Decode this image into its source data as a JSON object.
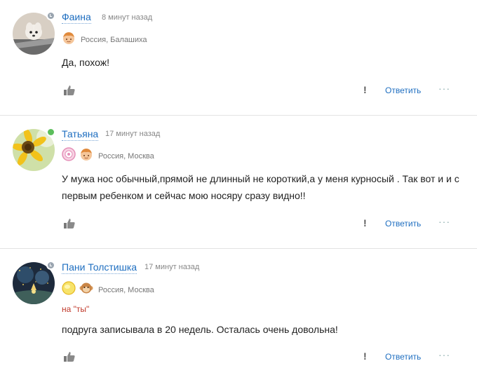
{
  "comments": [
    {
      "author": "Фаина",
      "time": "8 минут назад",
      "location": "Россия, Балашиха",
      "status": "away",
      "badges": [
        "boy-avatar-icon"
      ],
      "tag": "",
      "text": "Да, похож!",
      "actions": {
        "report": "!",
        "reply": "Ответить",
        "more": "···"
      }
    },
    {
      "author": "Татьяна",
      "time": "17 минут назад",
      "location": "Россия, Москва",
      "status": "online",
      "badges": [
        "pink-circle-badge-icon",
        "boy-avatar-icon"
      ],
      "tag": "",
      "text": "У мужа нос обычный,прямой не длинный не короткий,а у меня курносый . Так вот и и с первым ребенком и сейчас мою носяру сразу видно!!",
      "actions": {
        "report": "!",
        "reply": "Ответить",
        "more": "···"
      }
    },
    {
      "author": "Пани Толстишка",
      "time": "17 минут назад",
      "location": "Россия, Москва",
      "status": "away",
      "badges": [
        "yellow-circle-badge-icon",
        "monkey-avatar-icon"
      ],
      "tag": "на \"ты\"",
      "text": "подруга записывала в 20 недель. Осталась очень довольна!",
      "actions": {
        "report": "!",
        "reply": "Ответить",
        "more": "···"
      }
    }
  ],
  "colors": {
    "link": "#1e6ec0",
    "online": "#5cbe5c",
    "away": "#9aa5b0",
    "tag": "#c0392b"
  }
}
